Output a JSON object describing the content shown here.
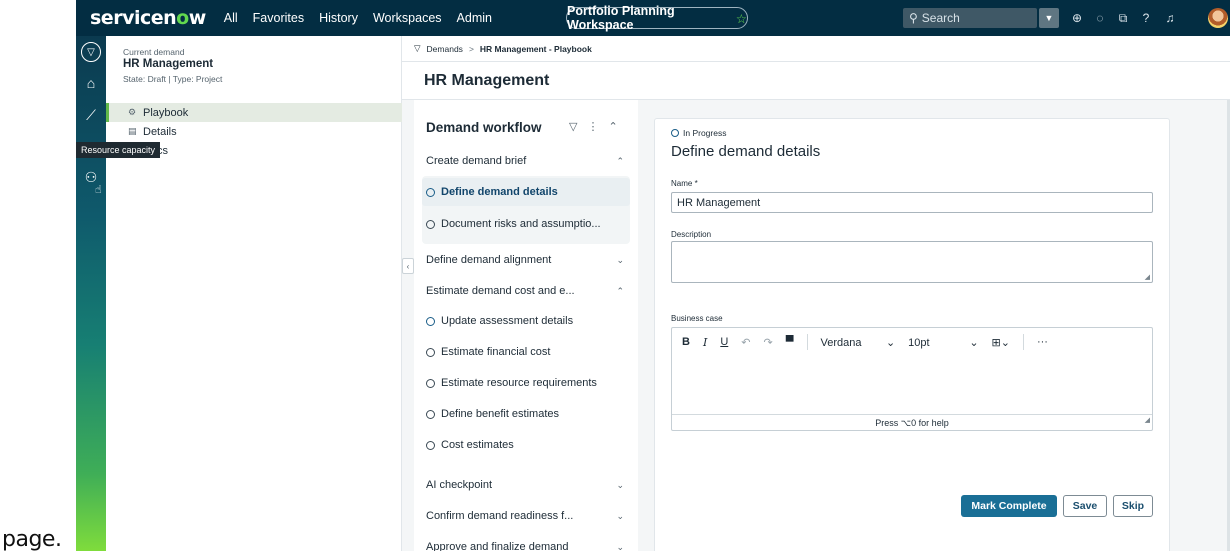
{
  "page_caption": "page.",
  "topnav": {
    "logo_pre": "servicen",
    "logo_o": "o",
    "logo_post": "w",
    "items": [
      "All",
      "Favorites",
      "History",
      "Workspaces",
      "Admin"
    ],
    "workspace": "Portfolio Planning Workspace",
    "workspace_star": "☆",
    "search_placeholder": "Search"
  },
  "rail": {
    "tooltip": "Resource capacity"
  },
  "left_panel": {
    "label": "Current demand",
    "title": "HR Management",
    "meta": "State: Draft  |  Type: Project",
    "items": [
      "Playbook",
      "Details",
      "Docs"
    ]
  },
  "breadcrumb": {
    "root": "Demands",
    "separator": ">",
    "current": "HR Management - Playbook"
  },
  "page_title": "HR Management",
  "workflow": {
    "title": "Demand workflow",
    "stages": [
      "Create demand brief",
      "Define demand alignment",
      "Estimate demand cost and e...",
      "AI checkpoint",
      "Confirm demand readiness f...",
      "Approve and finalize demand"
    ],
    "brief_steps": [
      "Define demand details",
      "Document risks and assumptio..."
    ],
    "estimate_steps": [
      "Update assessment details",
      "Estimate financial cost",
      "Estimate resource requirements",
      "Define benefit estimates",
      "Cost estimates"
    ]
  },
  "card": {
    "status": "In Progress",
    "title": "Define demand details",
    "name_label": "Name",
    "name_required": "*",
    "name_value": "HR Management",
    "description_label": "Description",
    "business_case_label": "Business case",
    "font_name": "Verdana",
    "font_size": "10pt",
    "help_text": "Press ⌥0 for help",
    "mark_complete": "Mark Complete",
    "save": "Save",
    "skip": "Skip"
  }
}
